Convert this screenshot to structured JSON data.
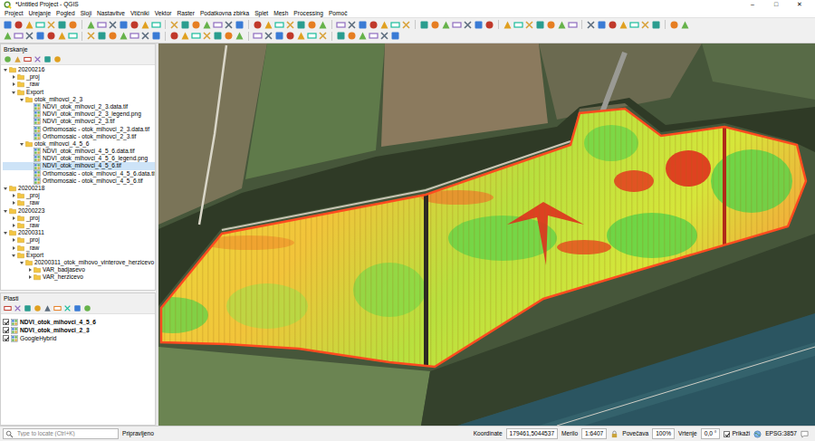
{
  "window": {
    "title": "*Untitled Project - QGIS",
    "controls": [
      "–",
      "□",
      "✕"
    ]
  },
  "menu": [
    "Project",
    "Urejanje",
    "Pogled",
    "Sloji",
    "Nastavitve",
    "Vtičniki",
    "Vektor",
    "Raster",
    "Podatkovna zbirka",
    "Splet",
    "Mesh",
    "Processing",
    "Pomoč"
  ],
  "browser": {
    "title": "Brskanje",
    "items": [
      {
        "label": "20200216",
        "kind": "folder",
        "expanded": true,
        "selected": false,
        "children": [
          {
            "label": "_proj",
            "kind": "folder",
            "expanded": false,
            "selected": false
          },
          {
            "label": "_raw",
            "kind": "folder",
            "expanded": false,
            "selected": false
          },
          {
            "label": "Export",
            "kind": "folder",
            "expanded": true,
            "selected": false,
            "children": [
              {
                "label": "otok_mihovci_2_3",
                "kind": "folder",
                "expanded": true,
                "selected": false,
                "children": [
                  {
                    "label": "NDVI_otok_mihovci_2_3.data.tif",
                    "kind": "raster",
                    "expanded": false,
                    "selected": false
                  },
                  {
                    "label": "NDVI_otok_mihovci_2_3_legend.png",
                    "kind": "raster",
                    "expanded": false,
                    "selected": false
                  },
                  {
                    "label": "NDVI_otok_mihovci_2_3.tif",
                    "kind": "raster",
                    "expanded": false,
                    "selected": false
                  },
                  {
                    "label": "Orthomosaic - otok_mihovci_2_3.data.tif",
                    "kind": "raster",
                    "expanded": false,
                    "selected": false
                  },
                  {
                    "label": "Orthomosaic - otok_mihovci_2_3.tif",
                    "kind": "raster",
                    "expanded": false,
                    "selected": false
                  }
                ]
              },
              {
                "label": "otok_mihovci_4_5_6",
                "kind": "folder",
                "expanded": true,
                "selected": false,
                "children": [
                  {
                    "label": "NDVI_otok_mihovci_4_5_6.data.tif",
                    "kind": "raster",
                    "expanded": false,
                    "selected": false
                  },
                  {
                    "label": "NDVI_otok_mihovci_4_5_6_legend.png",
                    "kind": "raster",
                    "expanded": false,
                    "selected": false
                  },
                  {
                    "label": "NDVI_otok_mihovci_4_5_6.tif",
                    "kind": "raster",
                    "expanded": false,
                    "selected": true
                  },
                  {
                    "label": "Orthomosaic - otok_mihovci_4_5_6.data.tif",
                    "kind": "raster",
                    "expanded": false,
                    "selected": false
                  },
                  {
                    "label": "Orthomosaic - otok_mihovci_4_5_6.tif",
                    "kind": "raster",
                    "expanded": false,
                    "selected": false
                  }
                ]
              }
            ]
          }
        ]
      },
      {
        "label": "20200218",
        "kind": "folder",
        "expanded": true,
        "selected": false,
        "children": [
          {
            "label": "_proj",
            "kind": "folder",
            "expanded": false,
            "selected": false
          },
          {
            "label": "_raw",
            "kind": "folder",
            "expanded": false,
            "selected": false
          }
        ]
      },
      {
        "label": "20200223",
        "kind": "folder",
        "expanded": true,
        "selected": false,
        "children": [
          {
            "label": "_proj",
            "kind": "folder",
            "expanded": false,
            "selected": false
          },
          {
            "label": "_raw",
            "kind": "folder",
            "expanded": false,
            "selected": false
          }
        ]
      },
      {
        "label": "20200311",
        "kind": "folder",
        "expanded": true,
        "selected": false,
        "children": [
          {
            "label": "_proj",
            "kind": "folder",
            "expanded": false,
            "selected": false
          },
          {
            "label": "_raw",
            "kind": "folder",
            "expanded": false,
            "selected": false
          },
          {
            "label": "Export",
            "kind": "folder",
            "expanded": true,
            "selected": false,
            "children": [
              {
                "label": "20200311_otok_mihovo_vinterove_herzicevo",
                "kind": "folder",
                "expanded": true,
                "selected": false,
                "children": [
                  {
                    "label": "VAR_badjasevo",
                    "kind": "folder",
                    "expanded": false,
                    "selected": false
                  },
                  {
                    "label": "VAR_herzicevo",
                    "kind": "folder",
                    "expanded": false,
                    "selected": false
                  }
                ]
              }
            ]
          }
        ]
      }
    ]
  },
  "layers": {
    "title": "Plasti",
    "items": [
      {
        "label": "NDVI_otok_mihovci_4_5_6",
        "checked": true,
        "emphasized": true
      },
      {
        "label": "NDVI_otok_mihovci_2_3",
        "checked": true,
        "emphasized": true
      },
      {
        "label": "GoogleHybrid",
        "checked": true,
        "emphasized": false
      }
    ]
  },
  "status_bar": {
    "search_placeholder": "Type to locate (Ctrl+K)",
    "message": "Pripravljeno",
    "coordinate_label": "Koordinate",
    "coordinate": "179461,5044537",
    "scale_label": "Merilo",
    "scale": "1:6407",
    "magnifier_label": "Povečava",
    "magnifier": "100%",
    "rotation_label": "Vrtenje",
    "rotation": "0,0 °",
    "render_label": "Prikaži",
    "render": true,
    "crs": "EPSG:3857"
  }
}
